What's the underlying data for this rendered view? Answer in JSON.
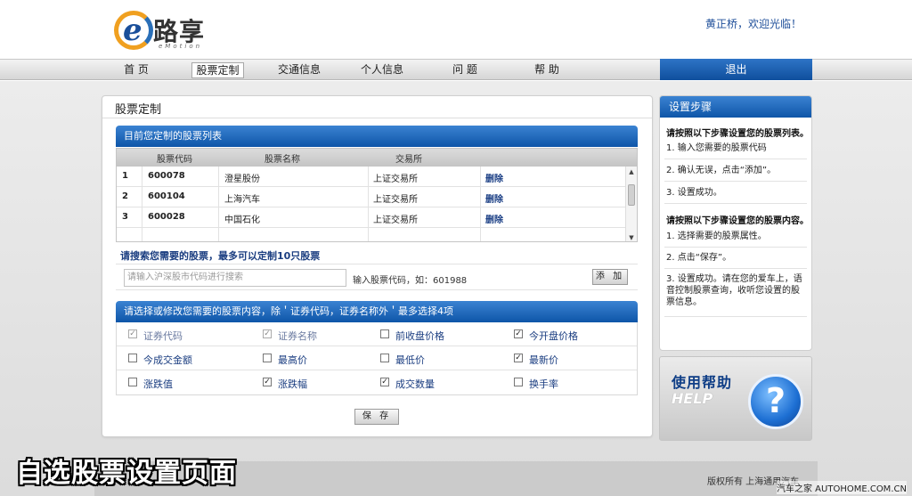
{
  "colors": {
    "accent": "#1a5fb4",
    "nav_bg": "#d6d6d6",
    "link": "#1b3f85"
  },
  "header": {
    "logo_text": "路享",
    "logo_sub": "eMotion",
    "welcome": "黄正桥，欢迎光临！"
  },
  "nav": {
    "items": [
      "首 页",
      "股票定制",
      "交通信息",
      "个人信息",
      "问 题",
      "帮 助"
    ],
    "active": "股票定制",
    "logout": "退出"
  },
  "main": {
    "title": "股票定制",
    "list_header": "目前您定制的股票列表",
    "columns": [
      "股票代码",
      "股票名称",
      "交易所"
    ],
    "rows": [
      {
        "no": "1",
        "code": "600078",
        "name": "澄星股份",
        "exchange": "上证交易所",
        "action": "删除"
      },
      {
        "no": "2",
        "code": "600104",
        "name": "上海汽车",
        "exchange": "上证交易所",
        "action": "删除"
      },
      {
        "no": "3",
        "code": "600028",
        "name": "中国石化",
        "exchange": "上证交易所",
        "action": "删除"
      }
    ],
    "search_hint": "请搜索您需要的股票，最多可以定制10只股票",
    "search_placeholder": "请输入沪深股市代码进行搜索",
    "search_label": "输入股票代码，如：601988",
    "add_button": "添 加",
    "options_header": "请选择或修改您需要的股票内容，除＇证券代码，证券名称外＇最多选择4项",
    "options": [
      [
        {
          "label": "证券代码",
          "checked": true,
          "disabled": true
        },
        {
          "label": "证券名称",
          "checked": true,
          "disabled": true
        },
        {
          "label": "前收盘价格",
          "checked": false
        },
        {
          "label": "今开盘价格",
          "checked": true
        }
      ],
      [
        {
          "label": "今成交金额",
          "checked": false
        },
        {
          "label": "最高价",
          "checked": false
        },
        {
          "label": "最低价",
          "checked": false
        },
        {
          "label": "最新价",
          "checked": true
        }
      ],
      [
        {
          "label": "涨跌值",
          "checked": false
        },
        {
          "label": "涨跌幅",
          "checked": true
        },
        {
          "label": "成交数量",
          "checked": true
        },
        {
          "label": "换手率",
          "checked": false
        }
      ]
    ],
    "save_button": "保 存"
  },
  "side": {
    "title": "设置步骤",
    "section1": "请按照以下步骤设置您的股票列表。",
    "steps1": [
      "1. 输入您需要的股票代码",
      "2. 确认无误，点击“添加”。",
      "3. 设置成功。"
    ],
    "section2": "请按照以下步骤设置您的股票内容。",
    "steps2": [
      "1. 选择需要的股票属性。",
      "2. 点击“保存”。",
      "3. 设置成功。请在您的爱车上，语音控制股票查询，收听您设置的股票信息。"
    ]
  },
  "help": {
    "cn": "使用帮助",
    "en": "HELP",
    "icon": "?"
  },
  "footer": {
    "copyright": "版权所有 上海通用汽车",
    "caption": "自选股票设置页面",
    "watermark": "汽车之家 AUTOHOME.COM.CN"
  }
}
